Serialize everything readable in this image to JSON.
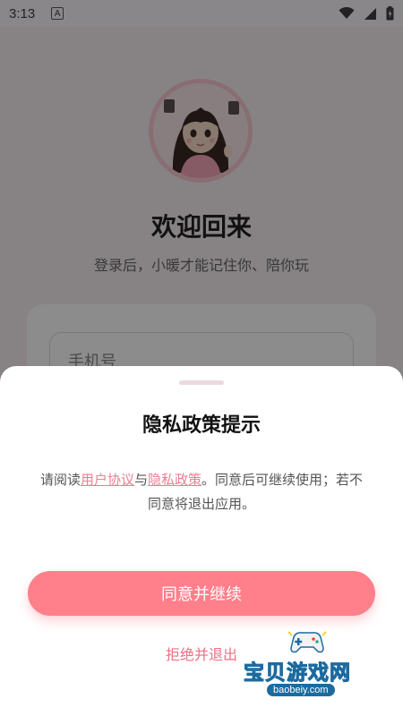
{
  "status_bar": {
    "time": "3:13",
    "badge": "A"
  },
  "welcome": {
    "title": "欢迎回来",
    "subtitle": "登录后，小暖才能记住你、陪你玩"
  },
  "login": {
    "phone_placeholder": "手机号"
  },
  "privacy_sheet": {
    "title": "隐私政策提示",
    "body_prefix": "请阅读",
    "user_agreement_link": "用户协议",
    "connector": "与",
    "privacy_policy_link": "隐私政策",
    "body_suffix": "。同意后可继续使用；若不同意将退出应用。",
    "agree_button": "同意并继续",
    "reject_button": "拒绝并退出"
  },
  "watermark": {
    "text": "宝贝游戏网",
    "url": "baobeiy.com"
  },
  "colors": {
    "accent": "#ff7f8b",
    "link": "#ee7d92",
    "overlay": "rgba(0,0,0,0.45)"
  }
}
